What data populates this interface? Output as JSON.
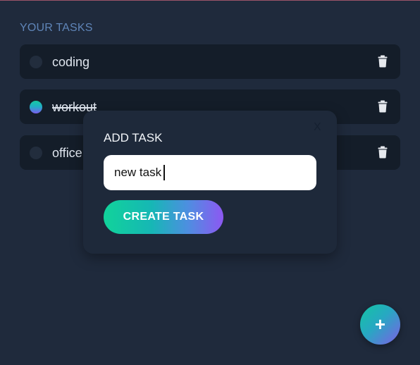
{
  "heading": "YOUR TASKS",
  "tasks": [
    {
      "label": "coding",
      "completed": false
    },
    {
      "label": "workout",
      "completed": true
    },
    {
      "label": "office",
      "completed": false
    }
  ],
  "modal": {
    "title": "ADD TASK",
    "close_label": "X",
    "input_value": "new task",
    "create_label": "CREATE TASK"
  },
  "fab": {
    "label": "+"
  },
  "colors": {
    "background": "#1f2a3c",
    "task_bg": "#141d29",
    "heading": "#5f85b8",
    "accent_start": "#11d39a",
    "accent_end": "#8d58f2"
  },
  "icons": {
    "delete": "trash-icon",
    "add": "plus-icon",
    "close": "close-icon"
  }
}
